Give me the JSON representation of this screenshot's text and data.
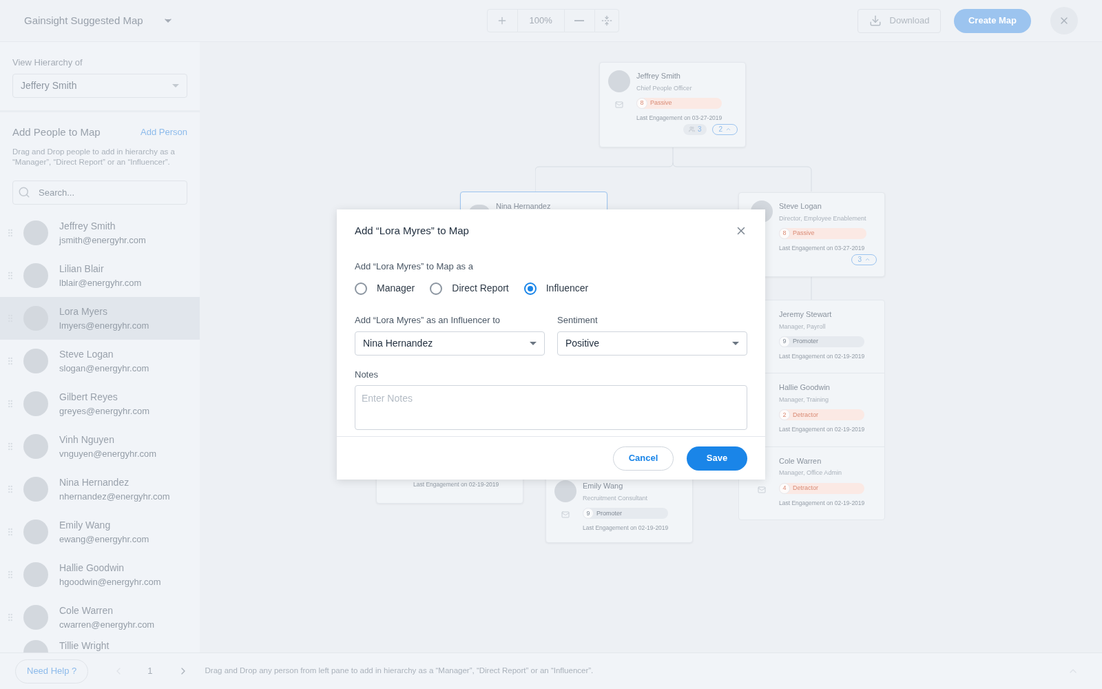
{
  "header": {
    "title": "Gainsight Suggested Map",
    "zoom": "100%",
    "buttons": [
      {
        "label": "Download",
        "kind": "secondary"
      },
      {
        "label": "Create Map",
        "kind": "primary"
      }
    ]
  },
  "sidebar": {
    "hierarchy_label": "View Hierarchy of",
    "hierarchy_value": "Jeffery Smith",
    "section_title": "Add People to Map",
    "add_link": "Add Person",
    "description": "Drag and Drop people to add in hierarchy as a “Manager”, “Direct Report” or an “Influencer”.",
    "search_placeholder": "Search...",
    "people": [
      {
        "name": "Jeffrey Smith",
        "email": "jsmith@energyhr.com",
        "selected": false
      },
      {
        "name": "Lilian Blair",
        "email": "lblair@energyhr.com",
        "selected": false
      },
      {
        "name": "Lora Myers",
        "email": "lmyers@energyhr.com",
        "selected": true
      },
      {
        "name": "Steve Logan",
        "email": "slogan@energyhr.com",
        "selected": false
      },
      {
        "name": "Gilbert Reyes",
        "email": "greyes@energyhr.com",
        "selected": false
      },
      {
        "name": "Vinh Nguyen",
        "email": "vnguyen@energyhr.com",
        "selected": false
      },
      {
        "name": "Nina Hernandez",
        "email": "nhernandez@energyhr.com",
        "selected": false
      },
      {
        "name": "Emily Wang",
        "email": "ewang@energyhr.com",
        "selected": false
      },
      {
        "name": "Hallie Goodwin",
        "email": "hgoodwin@energyhr.com",
        "selected": false
      },
      {
        "name": "Cole Warren",
        "email": "cwarren@energyhr.com",
        "selected": false
      }
    ],
    "partial_person": "Tillie Wright"
  },
  "map": {
    "nodes": [
      {
        "name": "Jeffrey Smith",
        "title": "Chief People Officer",
        "mail": true,
        "score": "8",
        "sentiment": "Passive",
        "kind": "passive",
        "engagement": "Last Engagement on 03-27-2019",
        "team_count": "3",
        "children_count": "2",
        "selected": false
      },
      {
        "name": "Nina Hernandez",
        "selected": true
      },
      {
        "name": "Steve Logan",
        "title": "Director, Employee Enablement",
        "mail": false,
        "score": "8",
        "sentiment": "Passive",
        "kind": "passive",
        "engagement": "Last Engagement on 03-27-2019",
        "children_count": "3",
        "selected": false
      },
      {
        "engagement": "Last Engagement on 02-19-2019",
        "selected": false
      },
      {
        "name": "Emily Wang",
        "title": "Recruitment Consultant",
        "mail": true,
        "score": "9",
        "sentiment": "Promoter",
        "kind": "promoter",
        "engagement": "Last Engagement on 02-19-2019",
        "selected": false
      }
    ],
    "group": [
      {
        "name": "Jeremy Stewart",
        "title": "Manager, Payroll",
        "mail": false,
        "score": "9",
        "sentiment": "Promoter",
        "kind": "promoter",
        "engagement": "Last Engagement on 02-19-2019"
      },
      {
        "name": "Hallie Goodwin",
        "title": "Manager, Training",
        "mail": false,
        "score": "2",
        "sentiment": "Detractor",
        "kind": "detractor",
        "engagement": "Last Engagement on 02-19-2019"
      },
      {
        "name": "Cole Warren",
        "title": "Manager, Office Admin",
        "mail": true,
        "score": "4",
        "sentiment": "Detractor",
        "kind": "detractor",
        "engagement": "Last Engagement on 02-19-2019"
      }
    ]
  },
  "modal": {
    "title": "Add “Lora Myres” to Map",
    "role_label": "Add “Lora Myres” to Map as a",
    "roles": [
      {
        "label": "Manager",
        "selected": false
      },
      {
        "label": "Direct Report",
        "selected": false
      },
      {
        "label": "Influencer",
        "selected": true
      }
    ],
    "target_label": "Add “Lora Myres” as an Influencer to",
    "target_value": "Nina Hernandez",
    "sentiment_label": "Sentiment",
    "sentiment_value": "Positive",
    "notes_label": "Notes",
    "notes_placeholder": "Enter Notes",
    "cancel": "Cancel",
    "save": "Save"
  },
  "footer": {
    "help": "Need Help ?",
    "page": "1",
    "hint": "Drag and Drop any person from left pane to add in hierarchy as a “Manager”, “Direct Report” or an “Influencer”."
  }
}
